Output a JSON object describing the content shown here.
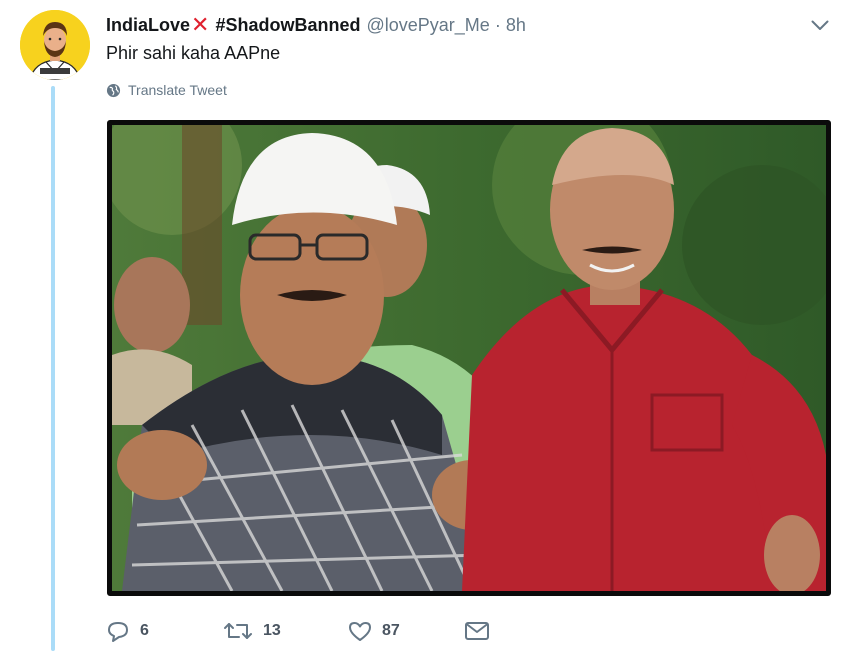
{
  "tweet": {
    "display_name": "IndiaLove",
    "hashtag": "#ShadowBanned",
    "handle": "@lovePyar_Me",
    "separator": "·",
    "time": "8h",
    "text": "Phir sahi kaha AAPne",
    "translate_label": "Translate Tweet"
  },
  "actions": {
    "replies": "6",
    "retweets": "13",
    "likes": "87"
  },
  "icons": {
    "avatar": "avatar-illustration",
    "name_emoji": "cross-mark-icon",
    "caret": "chevron-down-icon",
    "translate": "globe-icon",
    "reply": "reply-icon",
    "retweet": "retweet-icon",
    "like": "heart-icon",
    "dm": "envelope-icon"
  },
  "colors": {
    "thread_line": "#aadcf8",
    "secondary_text": "#657786",
    "cross_mark": "#e0202e",
    "avatar_bg": "#f7d21e"
  }
}
